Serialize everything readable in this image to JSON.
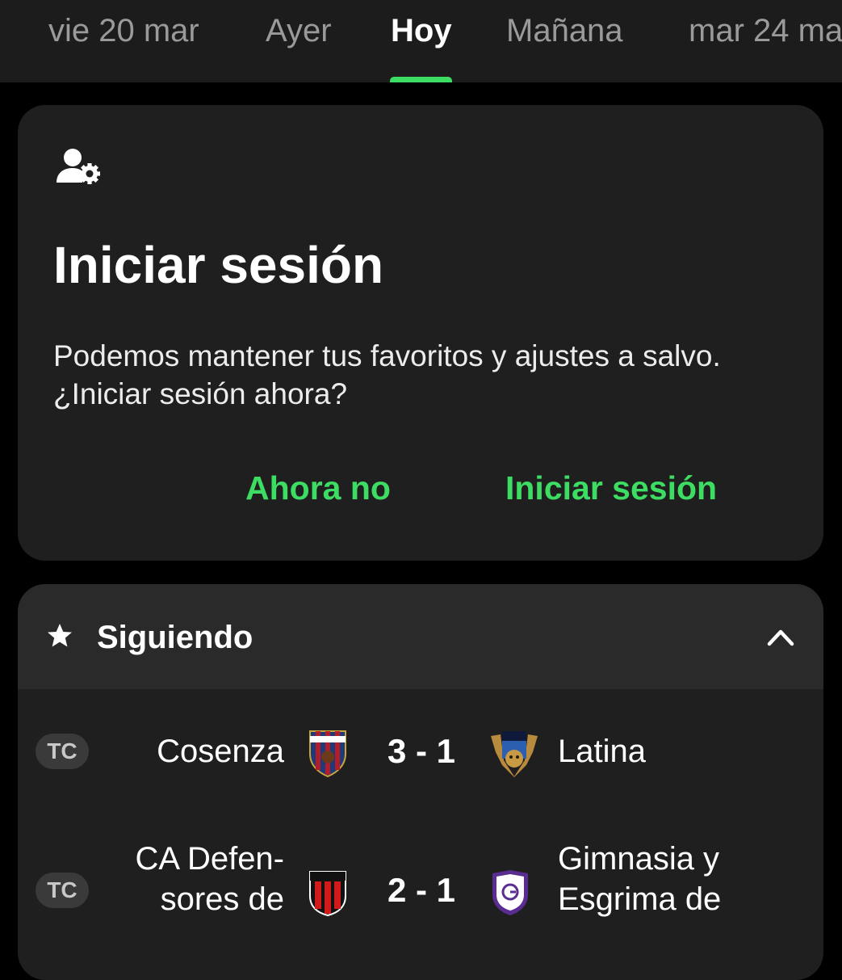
{
  "date_tabs": [
    {
      "label": "vie 20 mar",
      "active": false
    },
    {
      "label": "Ayer",
      "active": false
    },
    {
      "label": "Hoy",
      "active": true
    },
    {
      "label": "Mañana",
      "active": false
    },
    {
      "label": "mar 24 ma",
      "active": false
    }
  ],
  "colors": {
    "accent": "#3ddc63",
    "card": "#1f1f1f",
    "background": "#000000"
  },
  "login_card": {
    "icon": "user-gear-icon",
    "title": "Iniciar sesión",
    "body": "Podemos mantener tus favoritos y ajustes a salvo. ¿Iniciar sesión ahora?",
    "later_label": "Ahora no",
    "login_label": "Iniciar sesión"
  },
  "following": {
    "icon": "star-icon",
    "title": "Siguiendo",
    "collapse_icon": "chevron-up-icon",
    "matches": [
      {
        "badge": "TC",
        "home_lines": [
          "Cosenza"
        ],
        "score": "3 - 1",
        "away_lines": [
          "Latina"
        ]
      },
      {
        "badge": "TC",
        "home_lines": [
          "CA Defen-",
          "sores de"
        ],
        "score": "2 - 1",
        "away_lines": [
          "Gimnasia y",
          "Esgrima de"
        ]
      }
    ]
  }
}
